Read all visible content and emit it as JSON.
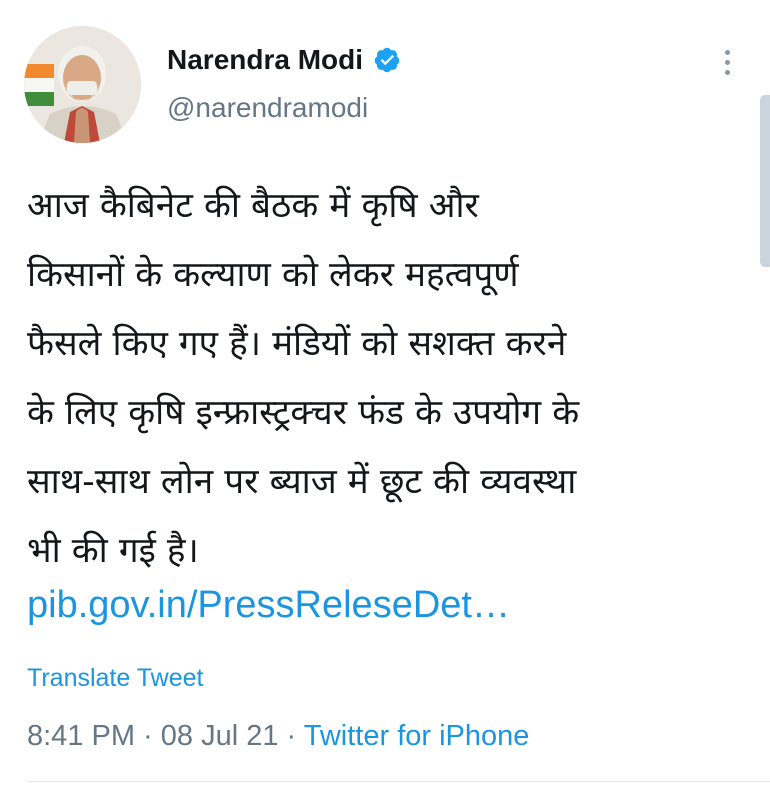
{
  "author": {
    "display_name": "Narendra Modi",
    "handle": "@narendramodi",
    "verified": true
  },
  "tweet": {
    "text_lines": [
      "आज कैबिनेट की बैठक में कृषि और",
      "किसानों के कल्याण को लेकर महत्वपूर्ण",
      "फैसले किए गए हैं। मंडियों को सशक्त करने",
      "के लिए कृषि इन्फ्रास्ट्रक्चर फंड के उपयोग के",
      "साथ-साथ लोन पर ब्याज में छूट की व्यवस्था",
      "भी की गई है।"
    ],
    "link": "pib.gov.in/PressReleseDet…",
    "translate_label": "Translate Tweet",
    "time": "8:41 PM",
    "separator": " · ",
    "date": "08 Jul 21",
    "source": "Twitter for iPhone"
  },
  "icons": {
    "verified": "verified-badge-icon",
    "more": "more-vertical-icon"
  },
  "colors": {
    "link": "#1b95e0",
    "secondary_text": "#657786",
    "primary_text": "#14171a",
    "verified_badge": "#1da1f2"
  }
}
